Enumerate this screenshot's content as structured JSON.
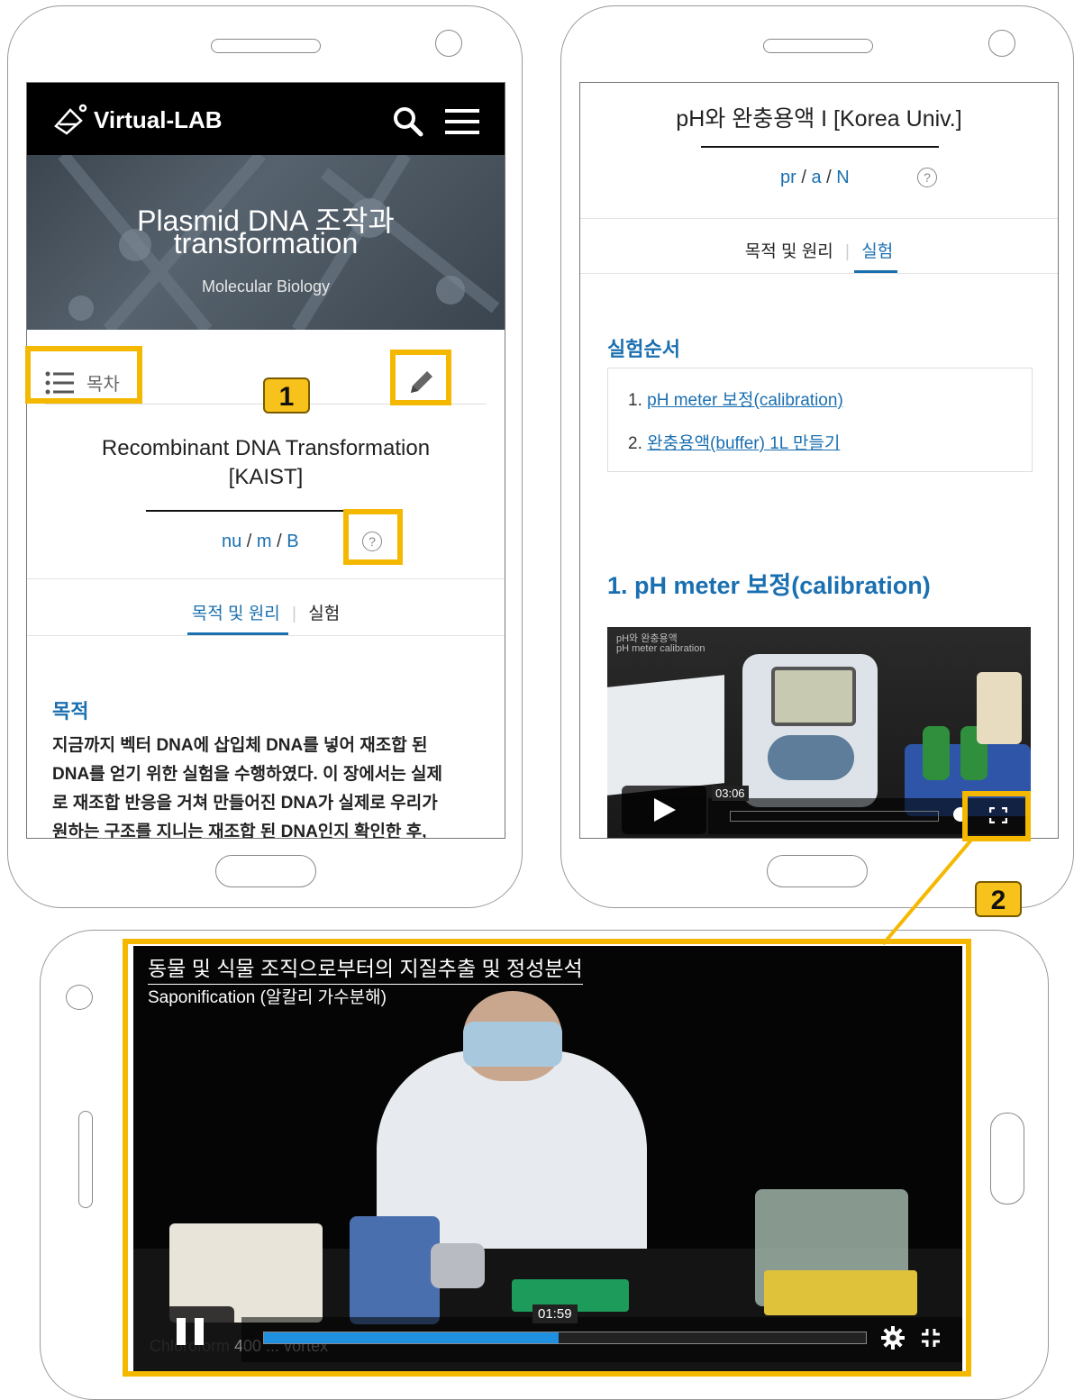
{
  "left_phone": {
    "brand": "Virtual-LAB",
    "hero_title_line1": "Plasmid DNA 조작과",
    "hero_title_line2": "transformation",
    "hero_subtitle": "Molecular Biology",
    "toc_label": "목차",
    "course_title_line1": "Recombinant DNA Transformation",
    "course_title_line2": "[KAIST]",
    "code_parts": [
      "nu",
      "m",
      "B"
    ],
    "tabs": [
      "목적 및 원리",
      "실험"
    ],
    "section_heading": "목적",
    "body_lines": [
      "지금까지 벡터 DNA에 삽입체 DNA를 넣어 재조합 된",
      "DNA를 얻기 위한 실험을 수행하였다. 이 장에서는 실제",
      "로 재조합 반응을 거쳐 만들어진 DNA가 실제로 우리가",
      "원하는 구조를 지니는 재조합 된 DNA인지 확인한 후,"
    ]
  },
  "right_phone": {
    "course_title": "pH와 완충용액 I [Korea Univ.]",
    "code_parts": [
      "pr",
      "a",
      "N"
    ],
    "tabs": [
      "목적 및 원리",
      "실험"
    ],
    "procedure_heading": "실험순서",
    "procedure_items": [
      {
        "num": "1.",
        "label": "pH meter 보정(calibration)"
      },
      {
        "num": "2.",
        "label": "완충용액(buffer) 1L 만들기"
      }
    ],
    "section_title": "1. pH meter 보정(calibration)",
    "video_overlay_line1": "pH와 완충용액",
    "video_overlay_line2": "pH meter calibration",
    "video_time": "03:06"
  },
  "landscape_phone": {
    "video_title": "동물 및 식물 조직으로부터의 지질추출 및 정성분석",
    "video_subtitle": "Saponification (알칼리 가수분해)",
    "video_time": "01:59",
    "progress_fraction": 0.49,
    "caption_fragment": "Chloroform 400 ... vortex"
  },
  "annotations": {
    "badge1": "1",
    "badge2": "2"
  },
  "colors": {
    "highlight": "#f5b800",
    "link_blue": "#1a6fb0",
    "progress_blue": "#1f8fe0"
  }
}
